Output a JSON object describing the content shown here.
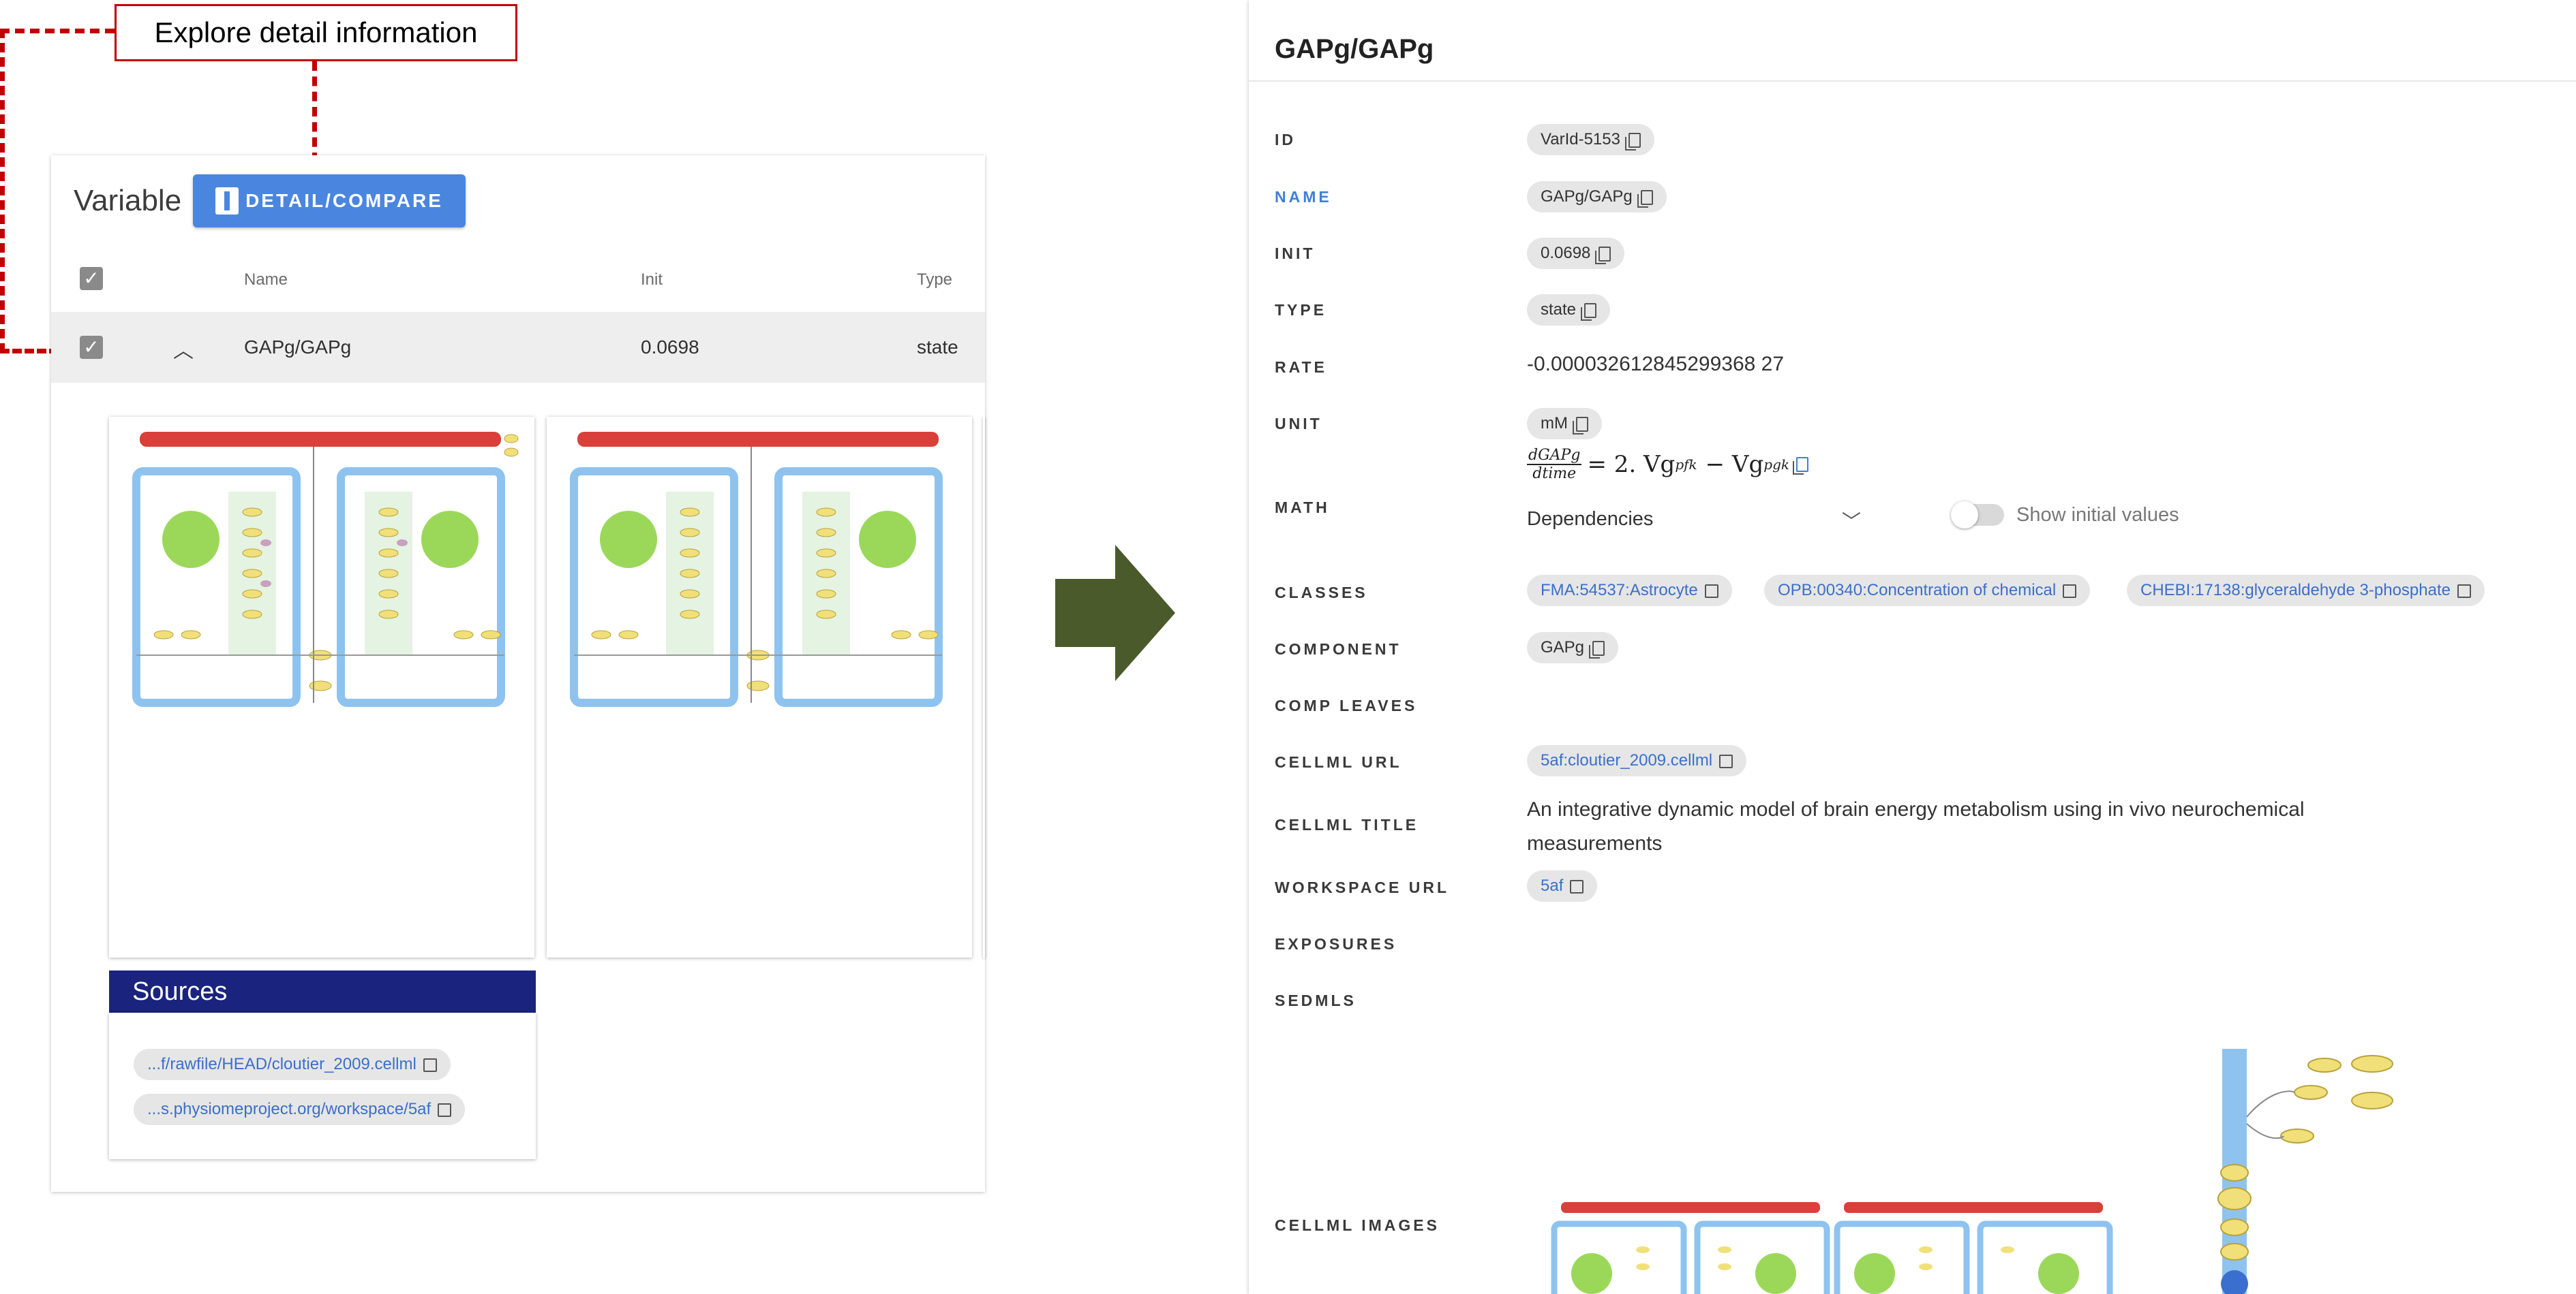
{
  "annotation": {
    "callout_text": "Explore detail information",
    "color": "#c00000"
  },
  "variable_panel": {
    "title": "Variable",
    "detail_button_label": "DETAIL/COMPARE",
    "columns": [
      "Name",
      "Init",
      "Type"
    ],
    "row": {
      "name": "GAPg/GAPg",
      "init": "0.0698",
      "type": "state",
      "expand_icon": "chevron-up-icon",
      "checked": true
    },
    "sources": {
      "title": "Sources",
      "links": [
        "...f/rawfile/HEAD/cloutier_2009.cellml",
        "...s.physiomeproject.org/workspace/5af"
      ]
    }
  },
  "detail_panel": {
    "title": "GAPg/GAPg",
    "fields": {
      "id": {
        "label": "ID",
        "value": "VarId-5153"
      },
      "name": {
        "label": "NAME",
        "value": "GAPg/GAPg"
      },
      "init": {
        "label": "INIT",
        "value": "0.0698"
      },
      "type": {
        "label": "TYPE",
        "value": "state"
      },
      "rate": {
        "label": "RATE",
        "value": "-0.000032612845299368 27"
      },
      "unit": {
        "label": "UNIT",
        "value": "mM"
      },
      "math": {
        "label": "MATH",
        "numerator": "dGAPg",
        "denominator": "dtime",
        "rhs": "= 2. Vg",
        "sub1": "pfk",
        "minus": "− Vg",
        "sub2": "pgk",
        "dependencies_label": "Dependencies",
        "show_initial_label": "Show initial values"
      },
      "classes": {
        "label": "CLASSES",
        "values": [
          "FMA:54537:Astrocyte",
          "OPB:00340:Concentration of chemical",
          "CHEBI:17138:glyceraldehyde 3-phosphate"
        ]
      },
      "component": {
        "label": "COMPONENT",
        "value": "GAPg"
      },
      "comp_leaves": {
        "label": "COMP LEAVES"
      },
      "cellml_url": {
        "label": "CELLML URL",
        "value": "5af:cloutier_2009.cellml"
      },
      "cellml_title": {
        "label": "CELLML TITLE",
        "value": "An integrative dynamic model of brain energy metabolism using in vivo neurochemical measurements"
      },
      "workspace_url": {
        "label": "WORKSPACE URL",
        "value": "5af"
      },
      "exposures": {
        "label": "EXPOSURES"
      },
      "sedmls": {
        "label": "SEDMLS"
      },
      "cellml_images": {
        "label": "CELLML IMAGES"
      }
    }
  },
  "colors": {
    "accent": "#4a86e0",
    "link": "#3b6fc9",
    "sources_header": "#1a237e",
    "arrow": "#4a5a2a",
    "diagram_red": "#d9403a",
    "diagram_blue": "#8ec3ef",
    "diagram_yellow": "#f1e07a",
    "diagram_green": "#9bd85a"
  }
}
